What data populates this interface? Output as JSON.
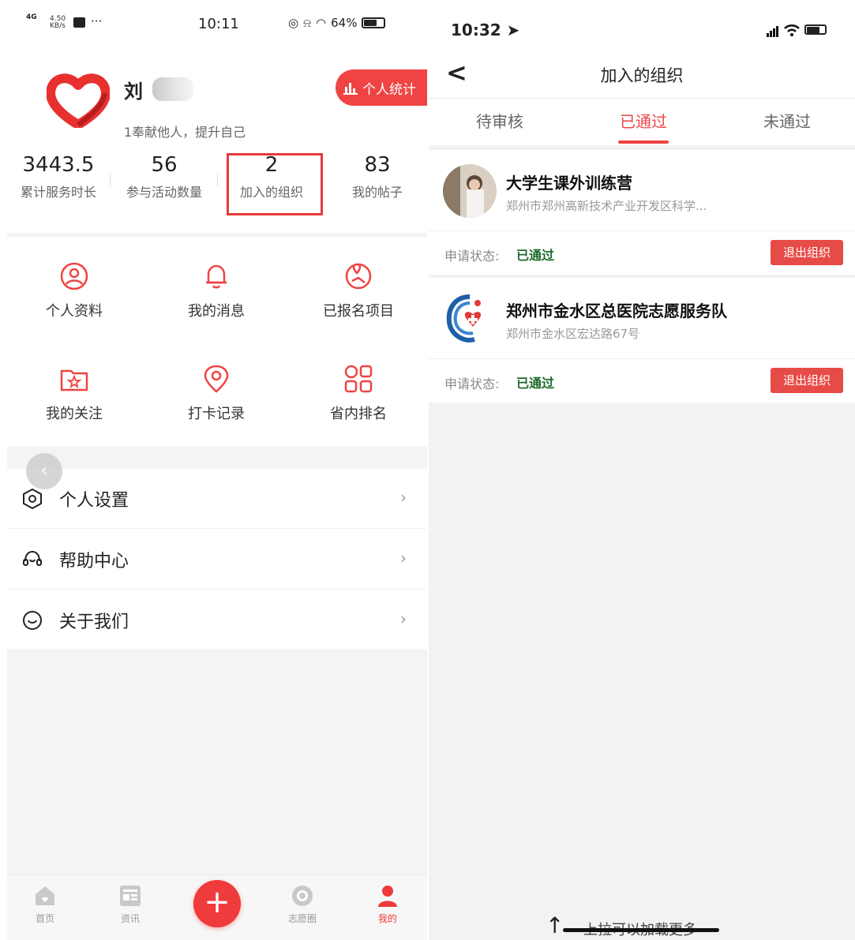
{
  "left_phone": {
    "statusbar": {
      "network": "4G",
      "speed": "4.50",
      "speed_unit": "KB/s",
      "dots": "···",
      "time": "10:11",
      "battery": "64%"
    },
    "profile": {
      "name": "刘",
      "motto": "1奉献他人，提升自己",
      "stats_button": "个人统计"
    },
    "stats": [
      {
        "value": "3443.5",
        "label": "累计服务时长"
      },
      {
        "value": "56",
        "label": "参与活动数量"
      },
      {
        "value": "2",
        "label": "加入的组织"
      },
      {
        "value": "83",
        "label": "我的帖子"
      }
    ],
    "grid": [
      {
        "label": "个人资料",
        "icon": "user-circle-icon"
      },
      {
        "label": "我的消息",
        "icon": "bell-icon"
      },
      {
        "label": "已报名项目",
        "icon": "map-pin-icon"
      },
      {
        "label": "我的关注",
        "icon": "star-folder-icon"
      },
      {
        "label": "打卡记录",
        "icon": "location-icon"
      },
      {
        "label": "省内排名",
        "icon": "grid-icon"
      }
    ],
    "menu": [
      {
        "label": "个人设置",
        "icon": "settings-icon"
      },
      {
        "label": "帮助中心",
        "icon": "headset-icon"
      },
      {
        "label": "关于我们",
        "icon": "smile-icon"
      }
    ],
    "back_glyph": "‹",
    "tabbar": [
      {
        "label": "首页",
        "icon": "home-icon"
      },
      {
        "label": "资讯",
        "icon": "news-icon"
      },
      {
        "label": "志愿圈",
        "icon": "eye-icon"
      },
      {
        "label": "我的",
        "icon": "person-icon",
        "active": true
      }
    ],
    "fab": "+"
  },
  "right_phone": {
    "statusbar": {
      "time": "10:32"
    },
    "nav": {
      "back": "<",
      "title": "加入的组织"
    },
    "tabs": [
      "待审核",
      "已通过",
      "未通过"
    ],
    "active_tab": 1,
    "organizations": [
      {
        "name": "大学生课外训练营",
        "address": "郑州市郑州高新技术产业开发区科学...",
        "status_label": "申请状态:",
        "status": "已通过",
        "action": "退出组织"
      },
      {
        "name": "郑州市金水区总医院志愿服务队",
        "address": "郑州市金水区宏达路67号",
        "status_label": "申请状态:",
        "status": "已通过",
        "action": "退出组织"
      }
    ],
    "footer_hint": "上拉可以加载更多",
    "footer_arrow": "↑"
  },
  "colors": {
    "accent": "#ef4443",
    "status_green": "#1c6b2b",
    "highlight_border": "#e63a3a"
  }
}
